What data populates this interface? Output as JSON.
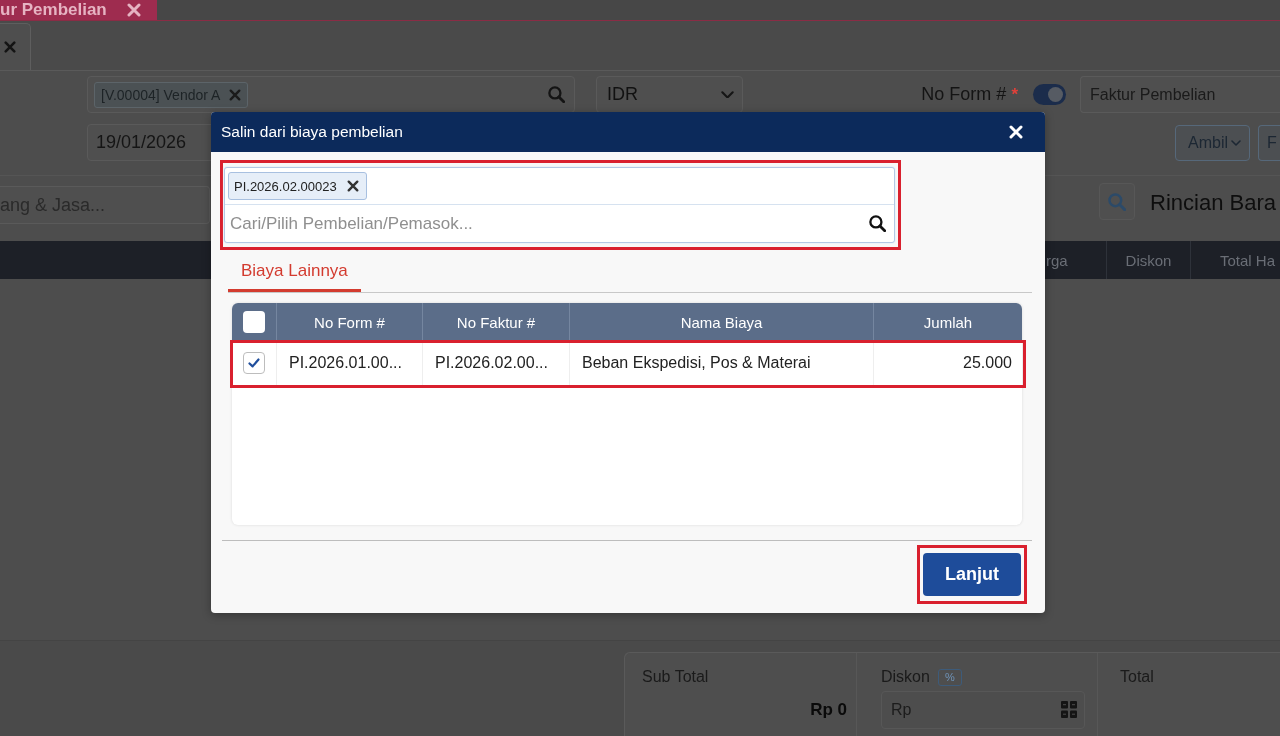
{
  "background_page": {
    "document_tabs": [
      {
        "label": "ur Pembelian",
        "selected": true
      }
    ],
    "vendor_field": {
      "tags": [
        "[V.00004] Vendor A"
      ]
    },
    "currency_select": {
      "value": "IDR"
    },
    "form_number": {
      "label": "No Form #",
      "required_mark": "*",
      "auto_number": true,
      "value": "Faktur Pembelian"
    },
    "date_field": {
      "value": "19/01/2026"
    },
    "toolbar_buttons": [
      {
        "label": "Ambil",
        "kind": "dropdown"
      },
      {
        "label": "F",
        "kind": "plain"
      }
    ],
    "item_search": {
      "placeholder": "ang & Jasa..."
    },
    "section_title": "Rincian Bara",
    "table": {
      "columns": [
        "rga",
        "Diskon",
        "Total Ha"
      ]
    },
    "summary": {
      "sub_total": {
        "label": "Sub Total",
        "value": "Rp 0"
      },
      "discount": {
        "label": "Diskon",
        "unit": "%",
        "placeholder": "Rp"
      },
      "total": {
        "label": "Total"
      }
    }
  },
  "dialog": {
    "title": "Salin dari biaya pembelian",
    "search": {
      "highlighted": true,
      "tags": [
        "PI.2026.02.00023"
      ],
      "placeholder": "Cari/Pilih Pembelian/Pemasok..."
    },
    "tabs": [
      {
        "label": "Biaya Lainnya",
        "selected": true
      }
    ],
    "table": {
      "select_all": false,
      "columns": [
        "No Form #",
        "No Faktur #",
        "Nama Biaya",
        "Jumlah"
      ],
      "rows": [
        {
          "checked": true,
          "highlighted": true,
          "cells": [
            "PI.2026.01.00...",
            "PI.2026.02.00...",
            "Beban Ekspedisi, Pos & Materai",
            "25.000"
          ]
        }
      ]
    },
    "buttons": [
      {
        "label": "Lanjut",
        "highlighted": true
      }
    ]
  }
}
